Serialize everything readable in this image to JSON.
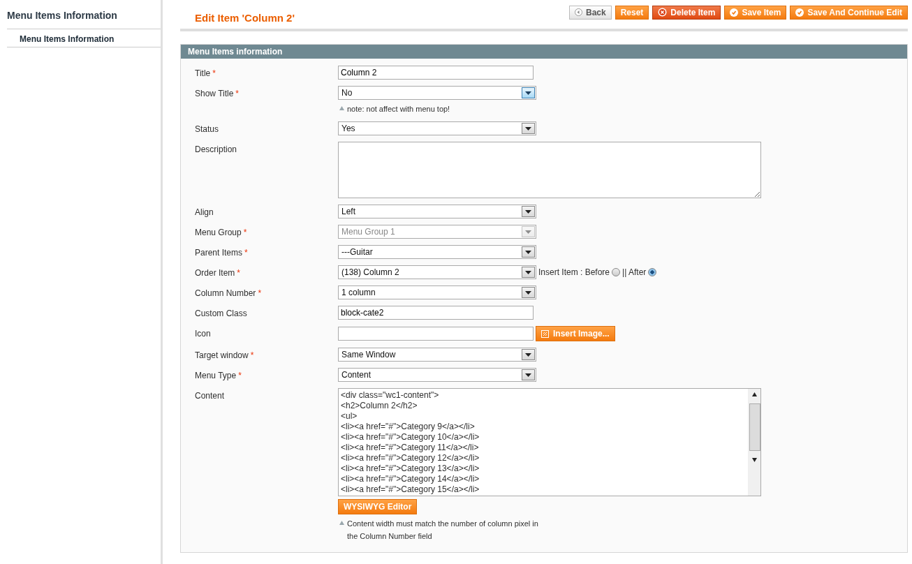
{
  "sidebar": {
    "title": "Menu Items Information",
    "items": [
      {
        "label": "Menu Items Information",
        "selected": true
      }
    ]
  },
  "page_title": "Edit Item 'Column 2'",
  "buttons": [
    {
      "kind": "back",
      "label": "Back"
    },
    {
      "kind": "plain",
      "label": "Reset"
    },
    {
      "kind": "delete",
      "label": "Delete Item"
    },
    {
      "kind": "save",
      "label": "Save Item"
    },
    {
      "kind": "save",
      "label": "Save And Continue Edit"
    }
  ],
  "section": {
    "title": "Menu Items information"
  },
  "fields": [
    {
      "kind": "text",
      "label": "Title",
      "required_mark": "*",
      "value": "Column 2"
    },
    {
      "kind": "select",
      "label": "Show Title",
      "required_mark": "*",
      "value": "No",
      "focused": true,
      "disabled": false,
      "note": "note: not affect with menu top!"
    },
    {
      "kind": "select",
      "label": "Status",
      "value": "Yes",
      "focused": false,
      "disabled": false
    },
    {
      "kind": "textarea",
      "label": "Description"
    },
    {
      "kind": "select",
      "label": "Align",
      "value": "Left",
      "focused": false,
      "disabled": false
    },
    {
      "kind": "select",
      "label": "Menu Group",
      "required_mark": "*",
      "value": "Menu Group 1",
      "focused": false,
      "disabled": true
    },
    {
      "kind": "select",
      "label": "Parent Items",
      "required_mark": "*",
      "value": "---Guitar",
      "focused": false,
      "disabled": false
    },
    {
      "kind": "select",
      "label": "Order Item",
      "required_mark": "*",
      "value": "(138) Column 2",
      "focused": false,
      "disabled": false,
      "insert": {
        "label": "Insert Item : Before",
        "separator": "|| After",
        "options": [
          {
            "selected": false
          },
          {
            "selected": true
          }
        ]
      }
    },
    {
      "kind": "select",
      "label": "Column Number",
      "required_mark": "*",
      "value": "1 column",
      "focused": false,
      "disabled": false
    },
    {
      "kind": "text",
      "label": "Custom Class",
      "value": "block-cate2"
    },
    {
      "kind": "image",
      "label": "Icon",
      "button": "Insert Image..."
    },
    {
      "kind": "select",
      "label": "Target window",
      "required_mark": "*",
      "value": "Same Window",
      "focused": false,
      "disabled": false
    },
    {
      "kind": "select",
      "label": "Menu Type",
      "required_mark": "*",
      "value": "Content",
      "focused": false,
      "disabled": false
    },
    {
      "kind": "code",
      "label": "Content",
      "lines": [
        "<div class=\"wc1-content\">",
        "<h2>Column 2</h2>",
        "<ul>",
        "<li><a href=\"#\">Category 9</a></li>",
        "<li><a href=\"#\">Category 10</a></li>",
        "<li><a href=\"#\">Category 11</a></li>",
        "<li><a href=\"#\">Category 12</a></li>",
        "<li><a href=\"#\">Category 13</a></li>",
        "<li><a href=\"#\">Category 14</a></li>",
        "<li><a href=\"#\">Category 15</a></li>"
      ],
      "button": "WYSIWYG Editor",
      "note": [
        "Content width must match the number of column pixel in",
        "the Column Number field"
      ]
    }
  ]
}
